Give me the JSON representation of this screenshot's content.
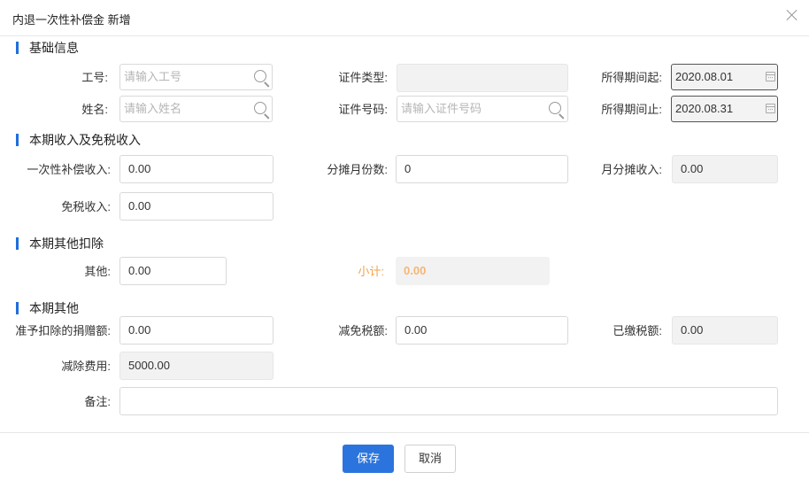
{
  "dialog": {
    "title": "内退一次性补偿金 新增"
  },
  "sections": {
    "basic": "基础信息",
    "income": "本期收入及免税收入",
    "deduct": "本期其他扣除",
    "other": "本期其他"
  },
  "basic": {
    "emp_no_label": "工号:",
    "emp_no_placeholder": "请输入工号",
    "id_type_label": "证件类型:",
    "id_type_value": "",
    "period_start_label": "所得期间起:",
    "period_start_value": "2020.08.01",
    "name_label": "姓名:",
    "name_placeholder": "请输入姓名",
    "id_no_label": "证件号码:",
    "id_no_placeholder": "请输入证件号码",
    "period_end_label": "所得期间止:",
    "period_end_value": "2020.08.31"
  },
  "income": {
    "lump_label": "一次性补偿收入:",
    "lump_value": "0.00",
    "months_label": "分摊月份数:",
    "months_value": "0",
    "monthly_label": "月分摊收入:",
    "monthly_value": "0.00",
    "taxfree_label": "免税收入:",
    "taxfree_value": "0.00"
  },
  "deduct": {
    "other_label": "其他:",
    "other_value": "0.00",
    "subtotal_label": "小计:",
    "subtotal_value": "0.00"
  },
  "other": {
    "donation_label": "准予扣除的捐赠额:",
    "donation_value": "0.00",
    "reduce_tax_label": "减免税额:",
    "reduce_tax_value": "0.00",
    "paid_tax_label": "已缴税额:",
    "paid_tax_value": "0.00",
    "deduct_fee_label": "减除费用:",
    "deduct_fee_value": "5000.00",
    "remark_label": "备注:",
    "remark_value": ""
  },
  "footer": {
    "save_label": "保存",
    "cancel_label": "取消"
  },
  "colors": {
    "accent": "#2b74de",
    "section_bar": "#1f6fd9",
    "subtotal": "#f0a24a"
  }
}
